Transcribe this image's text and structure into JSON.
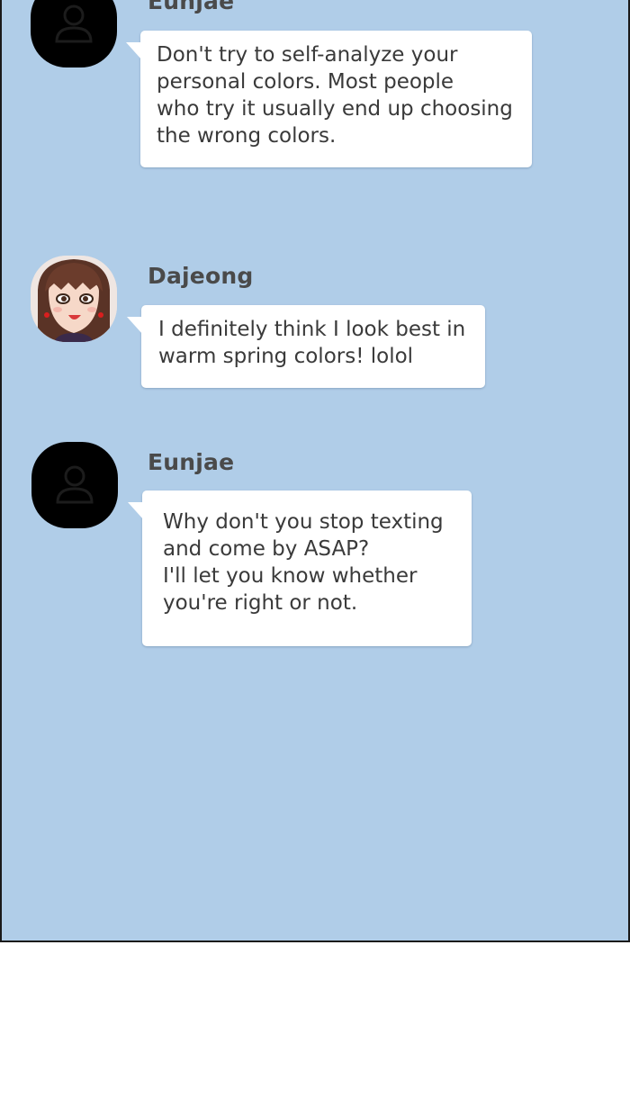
{
  "messages": [
    {
      "sender": "Eunjae",
      "avatar": "blank-person-icon",
      "lines": [
        "Don't try to self-analyze your",
        "personal colors. Most people",
        "who try it usually end up choosing",
        "the wrong colors."
      ]
    },
    {
      "sender": "Dajeong",
      "avatar": "dajeong-portrait",
      "lines": [
        "I definitely think I look best in",
        "warm spring colors! lolol"
      ]
    },
    {
      "sender": "Eunjae",
      "avatar": "blank-person-icon",
      "lines": [
        "Why don't you stop texting",
        "and come by ASAP?",
        "I'll let you know whether",
        "you're right or not."
      ]
    }
  ],
  "colors": {
    "chat_background": "#b0cde8",
    "bubble": "#ffffff",
    "name_text": "#4a4a4a",
    "message_text": "#3a3a3a"
  }
}
